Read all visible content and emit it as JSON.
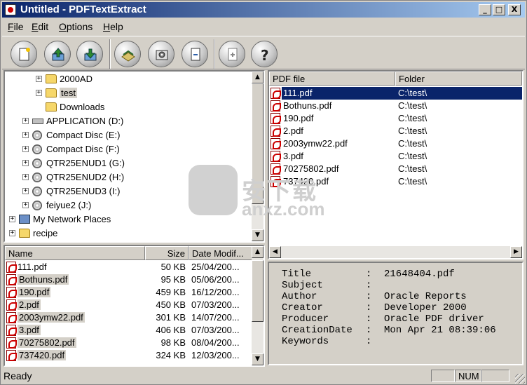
{
  "window": {
    "title": "Untitled - PDFTextExtract",
    "minimize": "_",
    "maximize": "□",
    "close": "X"
  },
  "menu": [
    {
      "label": "File",
      "key": "F",
      "rest": "ile"
    },
    {
      "label": "Edit",
      "key": "E",
      "rest": "dit"
    },
    {
      "label": "Options",
      "key": "O",
      "rest": "ptions"
    },
    {
      "label": "Help",
      "key": "H",
      "rest": "elp"
    }
  ],
  "toolbar": [
    {
      "name": "new-button",
      "icon": "new-document-icon"
    },
    {
      "name": "open-button",
      "icon": "open-upload-icon"
    },
    {
      "name": "save-button",
      "icon": "save-download-icon"
    },
    {
      "name": "extract-button",
      "icon": "extract-book-icon"
    },
    {
      "name": "settings-button",
      "icon": "gear-icon"
    },
    {
      "name": "remove-button",
      "icon": "minus-document-icon"
    },
    {
      "name": "add-button",
      "icon": "plus-document-icon"
    },
    {
      "name": "help-button",
      "icon": "question-icon"
    }
  ],
  "tree": [
    {
      "label": "2000AD",
      "indent": 2,
      "expander": "+",
      "icon": "folder"
    },
    {
      "label": "test",
      "indent": 2,
      "expander": "+",
      "icon": "folder",
      "selected": true
    },
    {
      "label": "Downloads",
      "indent": 2,
      "expander": "",
      "icon": "folder"
    },
    {
      "label": "APPLICATION (D:)",
      "indent": 1,
      "expander": "+",
      "icon": "drive"
    },
    {
      "label": "Compact Disc (E:)",
      "indent": 1,
      "expander": "+",
      "icon": "cd"
    },
    {
      "label": "Compact Disc (F:)",
      "indent": 1,
      "expander": "+",
      "icon": "cd"
    },
    {
      "label": "QTR25ENUD1 (G:)",
      "indent": 1,
      "expander": "+",
      "icon": "cd"
    },
    {
      "label": "QTR25ENUD2 (H:)",
      "indent": 1,
      "expander": "+",
      "icon": "cd"
    },
    {
      "label": "QTR25ENUD3 (I:)",
      "indent": 1,
      "expander": "+",
      "icon": "cd"
    },
    {
      "label": "feiyue2 (J:)",
      "indent": 1,
      "expander": "+",
      "icon": "cd"
    },
    {
      "label": "My Network Places",
      "indent": 0,
      "expander": "+",
      "icon": "net"
    },
    {
      "label": "recipe",
      "indent": 0,
      "expander": "+",
      "icon": "folder"
    }
  ],
  "file_list": {
    "headers": [
      "Name",
      "Size",
      "Date Modif..."
    ],
    "rows": [
      {
        "name": "111.pdf",
        "size": "50 KB",
        "date": "25/04/200..."
      },
      {
        "name": "Bothuns.pdf",
        "size": "95 KB",
        "date": "05/06/200..."
      },
      {
        "name": "190.pdf",
        "size": "459 KB",
        "date": "16/12/200..."
      },
      {
        "name": "2.pdf",
        "size": "450 KB",
        "date": "07/03/200..."
      },
      {
        "name": "2003ymw22.pdf",
        "size": "301 KB",
        "date": "14/07/200..."
      },
      {
        "name": "3.pdf",
        "size": "406 KB",
        "date": "07/03/200..."
      },
      {
        "name": "70275802.pdf",
        "size": "98 KB",
        "date": "08/04/200..."
      },
      {
        "name": "737420.pdf",
        "size": "324 KB",
        "date": "12/03/200..."
      }
    ]
  },
  "pdf_list": {
    "headers": [
      "PDF file",
      "Folder"
    ],
    "rows": [
      {
        "name": "111.pdf",
        "folder": "C:\\test\\",
        "selected": true
      },
      {
        "name": "Bothuns.pdf",
        "folder": "C:\\test\\"
      },
      {
        "name": "190.pdf",
        "folder": "C:\\test\\"
      },
      {
        "name": "2.pdf",
        "folder": "C:\\test\\"
      },
      {
        "name": "2003ymw22.pdf",
        "folder": "C:\\test\\"
      },
      {
        "name": "3.pdf",
        "folder": "C:\\test\\"
      },
      {
        "name": "70275802.pdf",
        "folder": "C:\\test\\"
      },
      {
        "name": "737420.pdf",
        "folder": "C:\\test\\"
      }
    ]
  },
  "info": [
    {
      "key": "Title",
      "value": "21648404.pdf"
    },
    {
      "key": "Subject",
      "value": ""
    },
    {
      "key": "Author",
      "value": "Oracle Reports"
    },
    {
      "key": "Creator",
      "value": "Developer 2000"
    },
    {
      "key": "Producer",
      "value": "Oracle PDF driver"
    },
    {
      "key": "CreationDate",
      "value": "Mon Apr 21 08:39:06"
    },
    {
      "key": "Keywords",
      "value": ""
    }
  ],
  "status": {
    "text": "Ready",
    "num": "NUM"
  },
  "watermark": {
    "text": "安下载",
    "sub": "anxz.com"
  },
  "colors": {
    "titlebar_start": "#0a246a",
    "titlebar_end": "#a6caf0",
    "selection": "#0a246a",
    "face": "#d4d0c8"
  }
}
